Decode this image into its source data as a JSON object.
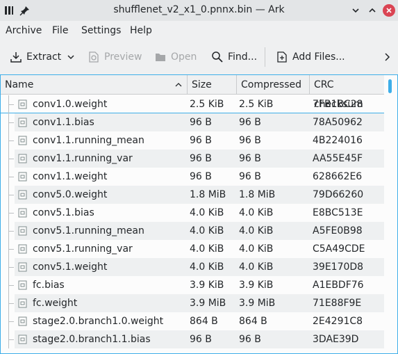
{
  "window": {
    "title": "shufflenet_v2_x1_0.pnnx.bin — Ark"
  },
  "menu": {
    "items": [
      "Archive",
      "File",
      "Settings",
      "Help"
    ]
  },
  "toolbar": {
    "extract": "Extract",
    "preview": "Preview",
    "open": "Open",
    "find": "Find...",
    "add_files": "Add Files..."
  },
  "columns": {
    "name": "Name",
    "size": "Size",
    "compressed": "Compressed",
    "crc": "CRC checksum"
  },
  "files": [
    {
      "name": "conv1.0.weight",
      "size": "2.5 KiB",
      "compressed": "2.5 KiB",
      "crc": "7FB1BC28"
    },
    {
      "name": "conv1.1.bias",
      "size": "96 B",
      "compressed": "96 B",
      "crc": "78A50962"
    },
    {
      "name": "conv1.1.running_mean",
      "size": "96 B",
      "compressed": "96 B",
      "crc": "4B224016"
    },
    {
      "name": "conv1.1.running_var",
      "size": "96 B",
      "compressed": "96 B",
      "crc": "AA55E45F"
    },
    {
      "name": "conv1.1.weight",
      "size": "96 B",
      "compressed": "96 B",
      "crc": "628662E6"
    },
    {
      "name": "conv5.0.weight",
      "size": "1.8 MiB",
      "compressed": "1.8 MiB",
      "crc": "79D66260"
    },
    {
      "name": "conv5.1.bias",
      "size": "4.0 KiB",
      "compressed": "4.0 KiB",
      "crc": "E8BC513E"
    },
    {
      "name": "conv5.1.running_mean",
      "size": "4.0 KiB",
      "compressed": "4.0 KiB",
      "crc": "A5FE0B98"
    },
    {
      "name": "conv5.1.running_var",
      "size": "4.0 KiB",
      "compressed": "4.0 KiB",
      "crc": "C5A49CDE"
    },
    {
      "name": "conv5.1.weight",
      "size": "4.0 KiB",
      "compressed": "4.0 KiB",
      "crc": "39E170D8"
    },
    {
      "name": "fc.bias",
      "size": "3.9 KiB",
      "compressed": "3.9 KiB",
      "crc": "A1EBDF76"
    },
    {
      "name": "fc.weight",
      "size": "3.9 MiB",
      "compressed": "3.9 MiB",
      "crc": "71E88F9E"
    },
    {
      "name": "stage2.0.branch1.0.weight",
      "size": "864 B",
      "compressed": "864 B",
      "crc": "2E4291C8"
    },
    {
      "name": "stage2.0.branch1.1.bias",
      "size": "96 B",
      "compressed": "96 B",
      "crc": "3DAE39D"
    }
  ]
}
